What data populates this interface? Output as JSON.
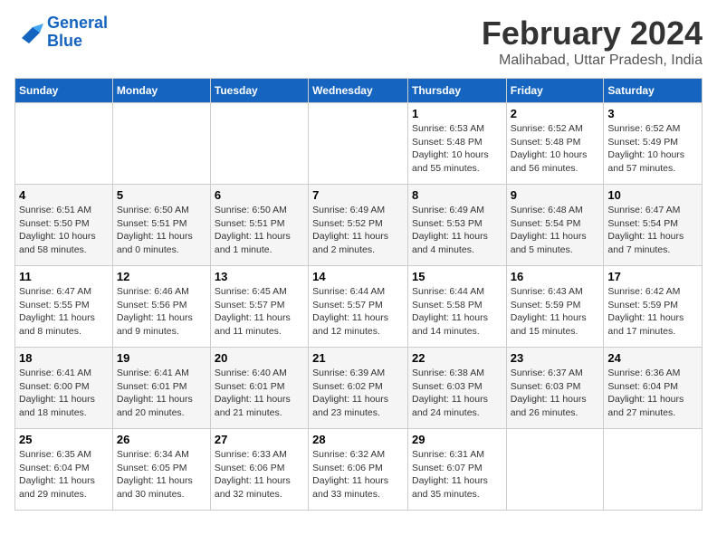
{
  "header": {
    "logo_line1": "General",
    "logo_line2": "Blue",
    "month_year": "February 2024",
    "location": "Malihabad, Uttar Pradesh, India"
  },
  "days_of_week": [
    "Sunday",
    "Monday",
    "Tuesday",
    "Wednesday",
    "Thursday",
    "Friday",
    "Saturday"
  ],
  "weeks": [
    [
      {
        "day": "",
        "info": ""
      },
      {
        "day": "",
        "info": ""
      },
      {
        "day": "",
        "info": ""
      },
      {
        "day": "",
        "info": ""
      },
      {
        "day": "1",
        "info": "Sunrise: 6:53 AM\nSunset: 5:48 PM\nDaylight: 10 hours and 55 minutes."
      },
      {
        "day": "2",
        "info": "Sunrise: 6:52 AM\nSunset: 5:48 PM\nDaylight: 10 hours and 56 minutes."
      },
      {
        "day": "3",
        "info": "Sunrise: 6:52 AM\nSunset: 5:49 PM\nDaylight: 10 hours and 57 minutes."
      }
    ],
    [
      {
        "day": "4",
        "info": "Sunrise: 6:51 AM\nSunset: 5:50 PM\nDaylight: 10 hours and 58 minutes."
      },
      {
        "day": "5",
        "info": "Sunrise: 6:50 AM\nSunset: 5:51 PM\nDaylight: 11 hours and 0 minutes."
      },
      {
        "day": "6",
        "info": "Sunrise: 6:50 AM\nSunset: 5:51 PM\nDaylight: 11 hours and 1 minute."
      },
      {
        "day": "7",
        "info": "Sunrise: 6:49 AM\nSunset: 5:52 PM\nDaylight: 11 hours and 2 minutes."
      },
      {
        "day": "8",
        "info": "Sunrise: 6:49 AM\nSunset: 5:53 PM\nDaylight: 11 hours and 4 minutes."
      },
      {
        "day": "9",
        "info": "Sunrise: 6:48 AM\nSunset: 5:54 PM\nDaylight: 11 hours and 5 minutes."
      },
      {
        "day": "10",
        "info": "Sunrise: 6:47 AM\nSunset: 5:54 PM\nDaylight: 11 hours and 7 minutes."
      }
    ],
    [
      {
        "day": "11",
        "info": "Sunrise: 6:47 AM\nSunset: 5:55 PM\nDaylight: 11 hours and 8 minutes."
      },
      {
        "day": "12",
        "info": "Sunrise: 6:46 AM\nSunset: 5:56 PM\nDaylight: 11 hours and 9 minutes."
      },
      {
        "day": "13",
        "info": "Sunrise: 6:45 AM\nSunset: 5:57 PM\nDaylight: 11 hours and 11 minutes."
      },
      {
        "day": "14",
        "info": "Sunrise: 6:44 AM\nSunset: 5:57 PM\nDaylight: 11 hours and 12 minutes."
      },
      {
        "day": "15",
        "info": "Sunrise: 6:44 AM\nSunset: 5:58 PM\nDaylight: 11 hours and 14 minutes."
      },
      {
        "day": "16",
        "info": "Sunrise: 6:43 AM\nSunset: 5:59 PM\nDaylight: 11 hours and 15 minutes."
      },
      {
        "day": "17",
        "info": "Sunrise: 6:42 AM\nSunset: 5:59 PM\nDaylight: 11 hours and 17 minutes."
      }
    ],
    [
      {
        "day": "18",
        "info": "Sunrise: 6:41 AM\nSunset: 6:00 PM\nDaylight: 11 hours and 18 minutes."
      },
      {
        "day": "19",
        "info": "Sunrise: 6:41 AM\nSunset: 6:01 PM\nDaylight: 11 hours and 20 minutes."
      },
      {
        "day": "20",
        "info": "Sunrise: 6:40 AM\nSunset: 6:01 PM\nDaylight: 11 hours and 21 minutes."
      },
      {
        "day": "21",
        "info": "Sunrise: 6:39 AM\nSunset: 6:02 PM\nDaylight: 11 hours and 23 minutes."
      },
      {
        "day": "22",
        "info": "Sunrise: 6:38 AM\nSunset: 6:03 PM\nDaylight: 11 hours and 24 minutes."
      },
      {
        "day": "23",
        "info": "Sunrise: 6:37 AM\nSunset: 6:03 PM\nDaylight: 11 hours and 26 minutes."
      },
      {
        "day": "24",
        "info": "Sunrise: 6:36 AM\nSunset: 6:04 PM\nDaylight: 11 hours and 27 minutes."
      }
    ],
    [
      {
        "day": "25",
        "info": "Sunrise: 6:35 AM\nSunset: 6:04 PM\nDaylight: 11 hours and 29 minutes."
      },
      {
        "day": "26",
        "info": "Sunrise: 6:34 AM\nSunset: 6:05 PM\nDaylight: 11 hours and 30 minutes."
      },
      {
        "day": "27",
        "info": "Sunrise: 6:33 AM\nSunset: 6:06 PM\nDaylight: 11 hours and 32 minutes."
      },
      {
        "day": "28",
        "info": "Sunrise: 6:32 AM\nSunset: 6:06 PM\nDaylight: 11 hours and 33 minutes."
      },
      {
        "day": "29",
        "info": "Sunrise: 6:31 AM\nSunset: 6:07 PM\nDaylight: 11 hours and 35 minutes."
      },
      {
        "day": "",
        "info": ""
      },
      {
        "day": "",
        "info": ""
      }
    ]
  ]
}
